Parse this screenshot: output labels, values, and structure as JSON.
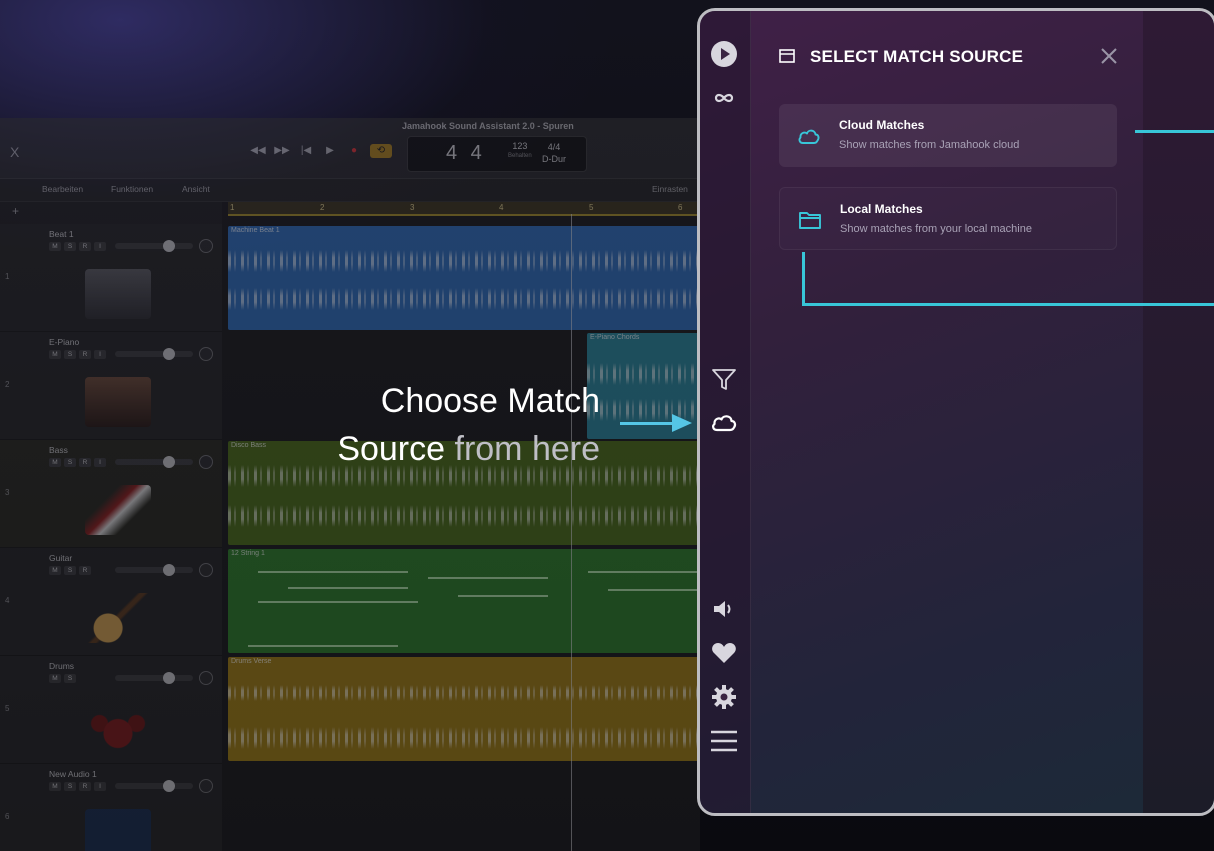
{
  "daw": {
    "window_title": "Jamahook Sound Assistant 2.0 - Spuren",
    "close_label": "X",
    "lcd": {
      "position": "4 4",
      "tempo": "123",
      "tempo_sub": "Behalten",
      "signature": "4/4",
      "key": "D-Dur"
    },
    "toolbar": {
      "edit": "Bearbeiten",
      "functions": "Funktionen",
      "view": "Ansicht",
      "snap": "Einrasten"
    },
    "ruler": [
      "1",
      "2",
      "3",
      "4",
      "5",
      "6"
    ],
    "tracks": [
      {
        "number": "1",
        "name": "Beat 1",
        "buttons": [
          "M",
          "S",
          "R",
          "I"
        ],
        "region": "Machine Beat 1"
      },
      {
        "number": "2",
        "name": "E-Piano",
        "buttons": [
          "M",
          "S",
          "R",
          "I"
        ],
        "region": "E-Piano Chords"
      },
      {
        "number": "3",
        "name": "Bass",
        "buttons": [
          "M",
          "S",
          "R",
          "I"
        ],
        "region": "Disco Bass"
      },
      {
        "number": "4",
        "name": "Guitar",
        "buttons": [
          "M",
          "S",
          "R"
        ],
        "region": "12 String 1"
      },
      {
        "number": "5",
        "name": "Drums",
        "buttons": [
          "M",
          "S"
        ],
        "region": "Drums Verse"
      },
      {
        "number": "6",
        "name": "New Audio 1",
        "buttons": [
          "M",
          "S",
          "R",
          "I"
        ],
        "region": ""
      }
    ]
  },
  "annotation": {
    "line1": "Choose Match",
    "line2_strong": "Source",
    "line2_dim": " from here"
  },
  "panel": {
    "title": "SELECT MATCH SOURCE",
    "options": [
      {
        "title": "Cloud Matches",
        "subtitle": "Show matches from Jamahook cloud",
        "icon": "cloud-icon",
        "selected": true
      },
      {
        "title": "Local Matches",
        "subtitle": "Show matches from your local machine",
        "icon": "folder-icon",
        "selected": false
      }
    ],
    "rail_icons": [
      "play-icon",
      "link-icon",
      "filter-icon",
      "cloud-icon",
      "volume-icon",
      "heart-icon",
      "settings-icon",
      "menu-icon"
    ]
  },
  "colors": {
    "accent": "#38c6d8",
    "arrow": "#55c6e6",
    "panel_bg": "#32203c"
  }
}
